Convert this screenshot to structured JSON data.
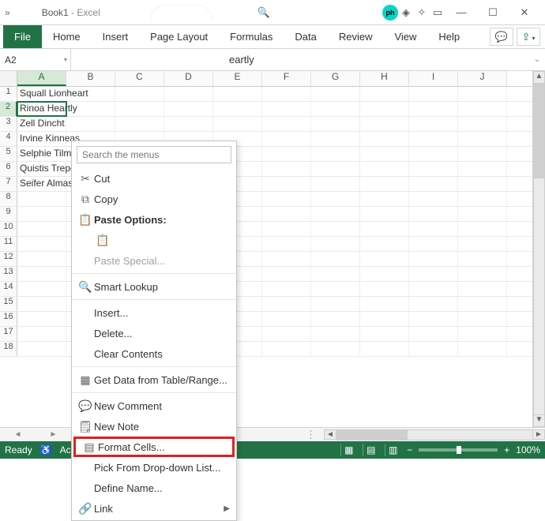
{
  "title": {
    "doc": "Book1",
    "sep": " - ",
    "app": "Excel"
  },
  "ribbon": {
    "file": "File",
    "tabs": [
      "Home",
      "Insert",
      "Page Layout",
      "Formulas",
      "Data",
      "Review",
      "View",
      "Help"
    ]
  },
  "namebox": "A2",
  "formula_value": "eartly",
  "columns": [
    "A",
    "B",
    "C",
    "D",
    "E",
    "F",
    "G",
    "H",
    "I",
    "J"
  ],
  "active_column_index": 0,
  "rows": [
    {
      "n": 1,
      "a": "Squall Lionheart"
    },
    {
      "n": 2,
      "a": "Rinoa Heartly",
      "active": true
    },
    {
      "n": 3,
      "a": "Zell Dincht"
    },
    {
      "n": 4,
      "a": "Irvine Kinneas"
    },
    {
      "n": 5,
      "a": "Selphie Tilmitt"
    },
    {
      "n": 6,
      "a": "Quistis Trepe"
    },
    {
      "n": 7,
      "a": "Seifer Almasy"
    },
    {
      "n": 8,
      "a": ""
    },
    {
      "n": 9,
      "a": ""
    },
    {
      "n": 10,
      "a": ""
    },
    {
      "n": 11,
      "a": ""
    },
    {
      "n": 12,
      "a": ""
    },
    {
      "n": 13,
      "a": ""
    },
    {
      "n": 14,
      "a": ""
    },
    {
      "n": 15,
      "a": ""
    },
    {
      "n": 16,
      "a": ""
    },
    {
      "n": 17,
      "a": ""
    },
    {
      "n": 18,
      "a": ""
    }
  ],
  "context_menu": {
    "search_placeholder": "Search the menus",
    "cut": "Cut",
    "copy": "Copy",
    "paste_options": "Paste Options:",
    "paste_special": "Paste Special...",
    "smart_lookup": "Smart Lookup",
    "insert": "Insert...",
    "delete": "Delete...",
    "clear": "Clear Contents",
    "get_data": "Get Data from Table/Range...",
    "new_comment": "New Comment",
    "new_note": "New Note",
    "format_cells": "Format Cells...",
    "pick_list": "Pick From Drop-down List...",
    "define_name": "Define Name...",
    "link": "Link"
  },
  "statusbar": {
    "ready": "Ready",
    "acc": "Acc",
    "zoom": "100%"
  }
}
